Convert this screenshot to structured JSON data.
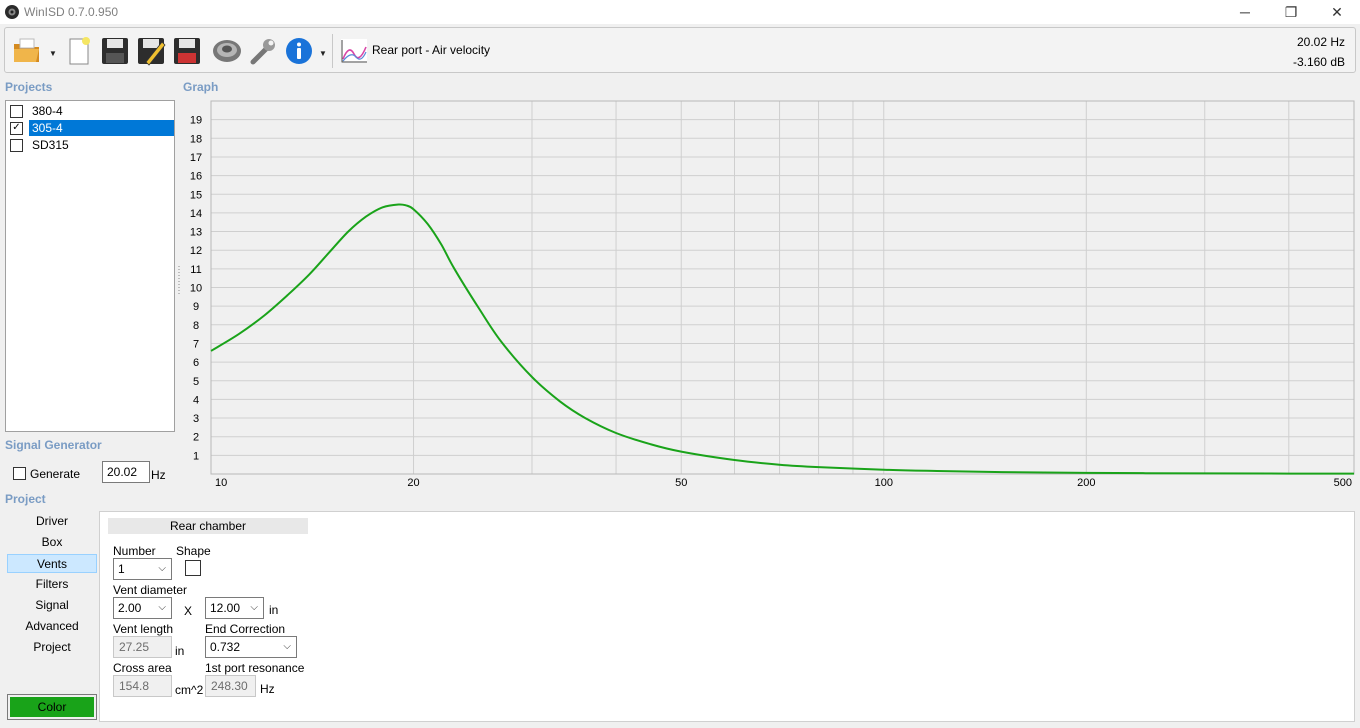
{
  "window": {
    "title": "WinISD 0.7.0.950",
    "minimize_glyph": "─",
    "maximize_glyph": "❐",
    "close_glyph": "✕"
  },
  "toolbar": {
    "buttons": [
      {
        "name": "open-folder-icon"
      },
      {
        "name": "new-document-icon"
      },
      {
        "name": "save-icon"
      },
      {
        "name": "save-as-icon"
      },
      {
        "name": "save-all-icon"
      },
      {
        "name": "speaker-driver-icon"
      },
      {
        "name": "wrench-icon"
      },
      {
        "name": "info-icon"
      },
      {
        "name": "graph-icon"
      }
    ],
    "graph_selector": "Rear port - Air velocity",
    "cursor_frequency": "20.02 Hz",
    "cursor_level": "-3.160 dB",
    "colors": {
      "info_blue": "#1a73d9",
      "folder_orange": "#e8a33c"
    }
  },
  "sections": {
    "projects": "Projects",
    "graph": "Graph",
    "signal_generator": "Signal Generator",
    "project": "Project"
  },
  "projects": [
    {
      "name": "380-4",
      "checked": false,
      "selected": false,
      "check_glyph": ""
    },
    {
      "name": "305-4",
      "checked": true,
      "selected": true,
      "check_glyph": "✓"
    },
    {
      "name": "SD315",
      "checked": false,
      "selected": false,
      "check_glyph": ""
    }
  ],
  "signal_generator": {
    "generate_label": "Generate",
    "generate_checked": false,
    "frequency": "20.02",
    "unit": "Hz"
  },
  "nav": {
    "items": [
      "Driver",
      "Box",
      "Vents",
      "Filters",
      "Signal",
      "Advanced",
      "Project"
    ],
    "active": "Vents",
    "color_button": "Color"
  },
  "vents": {
    "chamber": "Rear chamber",
    "number_label": "Number",
    "number_value": "1",
    "shape_label": "Shape",
    "vent_diameter_label": "Vent diameter",
    "diameter_value": "2.00",
    "x_label": "X",
    "second_dim_value": "12.00",
    "dim_unit": "in",
    "vent_length_label": "Vent length",
    "vent_length_value": "27.25",
    "vent_length_unit": "in",
    "end_correction_label": "End Correction",
    "end_correction_value": "0.732",
    "cross_area_label": "Cross area",
    "cross_area_value": "154.8",
    "cross_area_unit": "cm^2",
    "port_resonance_label": "1st port resonance",
    "port_resonance_value": "248.30",
    "port_resonance_unit": "Hz",
    "chevron": "⌵"
  },
  "chart_data": {
    "type": "line",
    "x_scale": "log",
    "xlim": [
      10,
      500
    ],
    "ylim": [
      0,
      20
    ],
    "x_ticks": [
      {
        "value": 10,
        "label": "10"
      },
      {
        "value": 20,
        "label": "20"
      },
      {
        "value": 50,
        "label": "50"
      },
      {
        "value": 100,
        "label": "100"
      },
      {
        "value": 200,
        "label": "200"
      },
      {
        "value": 500,
        "label": "500"
      }
    ],
    "y_ticks": [
      1,
      2,
      3,
      4,
      5,
      6,
      7,
      8,
      9,
      10,
      11,
      12,
      13,
      14,
      15,
      16,
      17,
      18,
      19
    ],
    "grid": true,
    "series": [
      {
        "color": "#1aa31a",
        "x": [
          10,
          11,
          12,
          13,
          14,
          15,
          16,
          17,
          18,
          19,
          19.5,
          20,
          21,
          22,
          23,
          25,
          27,
          30,
          33,
          36,
          40,
          45,
          50,
          60,
          70,
          80,
          100,
          120,
          150,
          200,
          300,
          400,
          500
        ],
        "y": [
          6.6,
          7.5,
          8.5,
          9.6,
          10.7,
          11.9,
          13.0,
          13.8,
          14.3,
          14.45,
          14.4,
          14.2,
          13.4,
          12.3,
          11.0,
          8.9,
          7.1,
          5.2,
          3.9,
          3.0,
          2.2,
          1.6,
          1.2,
          0.75,
          0.5,
          0.37,
          0.23,
          0.16,
          0.1,
          0.06,
          0.03,
          0.02,
          0.02
        ]
      }
    ]
  }
}
